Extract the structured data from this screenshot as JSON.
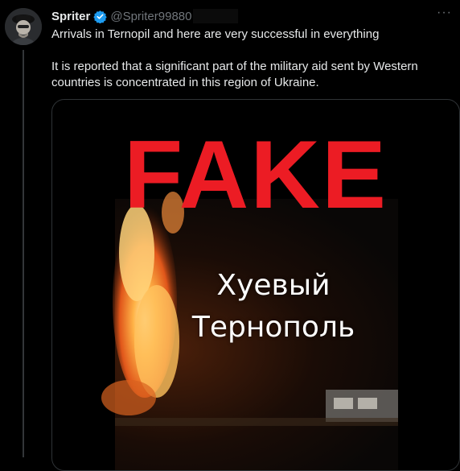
{
  "tweet": {
    "display_name": "Spriter",
    "handle": "@Spriter99880",
    "avatar_icon": "avatar-portrait-icon",
    "verified_icon": "verified-badge-icon",
    "more_icon": "more-horizontal-icon",
    "more_label": "···",
    "text_line1": "Arrivals in Ternopil and here are very successful in everything",
    "text_line2": "It is reported that a significant part of the military aid sent by Western countries is concentrated in this region of Ukraine."
  },
  "media": {
    "stamp_text": "FAKE",
    "caption_line1": "Хуевый",
    "caption_line2": "Тернополь"
  },
  "colors": {
    "background": "#000000",
    "stamp": "#ec1c24",
    "verified": "#1d9bf0",
    "secondary_text": "#71767b"
  }
}
